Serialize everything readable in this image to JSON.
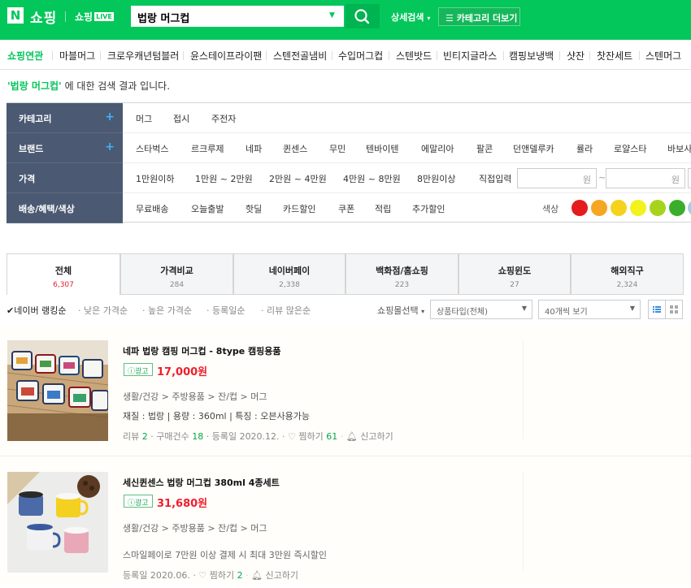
{
  "header": {
    "logo_letter": "N",
    "shop_label": "쇼핑",
    "shop_live_label": "쇼핑",
    "live_badge": "LIVE",
    "search_value": "법랑 머그컵",
    "detail_search_label": "상세검색",
    "category_more_label": "카테고리 더보기",
    "brand_color": "#03c75a"
  },
  "related": {
    "label": "쇼핑연관",
    "items": [
      "마블머그",
      "크로우캐년텀블러",
      "윤스테이프라이팬",
      "스텐전골냄비",
      "수입머그컵",
      "스텐밧드",
      "빈티지글라스",
      "캠핑보냉백",
      "샷잔",
      "찻잔세트",
      "스텐머그"
    ]
  },
  "result_message": {
    "query": "'법랑 머그컵'",
    "suffix": "에 대한 검색 결과 입니다."
  },
  "filters": {
    "category": {
      "label": "카테고리",
      "items": [
        "머그",
        "접시",
        "주전자"
      ]
    },
    "brand": {
      "label": "브랜드",
      "items": [
        "스타벅스",
        "르크루제",
        "네파",
        "퀸센스",
        "무민",
        "텐바이텐",
        "에말리아",
        "팔콘",
        "던앤델루카",
        "률라",
        "로얄스타",
        "바보사"
      ]
    },
    "price": {
      "label": "가격",
      "items": [
        "1만원이하",
        "1만원 ~ 2만원",
        "2만원 ~ 4만원",
        "4만원 ~ 8만원",
        "8만원이상",
        "직접입력"
      ],
      "min_unit": "원",
      "max_unit": "원",
      "tilde": "~"
    },
    "delivery": {
      "label": "배송/혜택/색상",
      "items": [
        "무료배송",
        "오늘출발",
        "핫딜",
        "카드할인",
        "쿠폰",
        "적립",
        "추가할인"
      ],
      "color_label": "색상"
    },
    "colors": [
      "#e41c1c",
      "#f5a623",
      "#f5d31c",
      "#f2f21c",
      "#a6d41c",
      "#3aae2a",
      "#9fd2e8"
    ]
  },
  "tabs": [
    {
      "name": "전체",
      "count": "6,307"
    },
    {
      "name": "가격비교",
      "count": "284"
    },
    {
      "name": "네이버페이",
      "count": "2,338"
    },
    {
      "name": "백화점/홈쇼핑",
      "count": "223"
    },
    {
      "name": "쇼핑윈도",
      "count": "27"
    },
    {
      "name": "해외직구",
      "count": "2,324"
    }
  ],
  "sort": {
    "options": [
      "✔네이버 랭킹순",
      "· 낮은 가격순",
      "· 높은 가격순",
      "· 등록일순",
      "· 리뷰 많은순"
    ],
    "mall_select": "쇼핑몰선택",
    "type_select": "상품타입(전체)",
    "view_select": "40개씩 보기"
  },
  "products": [
    {
      "title": "네파 법랑 캠핑 머그컵 - 8type 캠핑용품",
      "ad_label": "ⓘ광고",
      "price": "17,000원",
      "category": "생활/건강 > 주방용품 > 잔/컵 > 머그",
      "specs": "재질 : 법랑  |  용량 : 360ml  |  특징 : 오븐사용가능",
      "meta_review": "리뷰 ",
      "review_count": "2",
      "meta_purchase": " · 구매건수 ",
      "purchase_count": "18",
      "meta_date": " · 등록일 2020.12. · ",
      "wish_label": "찜하기 ",
      "wish_count": "61",
      "report_label": "신고하기"
    },
    {
      "title": "세신퀸센스 법랑 머그컵 380ml 4종세트",
      "ad_label": "ⓘ광고",
      "price": "31,680원",
      "category": "생활/건강 > 주방용품 > 잔/컵 > 머그",
      "promo": "스마일페이로 7만원 이상 결제 시 최대 3만원 즉시할인",
      "meta_date": "등록일 2020.06. · ",
      "wish_label": "찜하기 ",
      "wish_count": "2",
      "report_label": "신고하기"
    }
  ]
}
